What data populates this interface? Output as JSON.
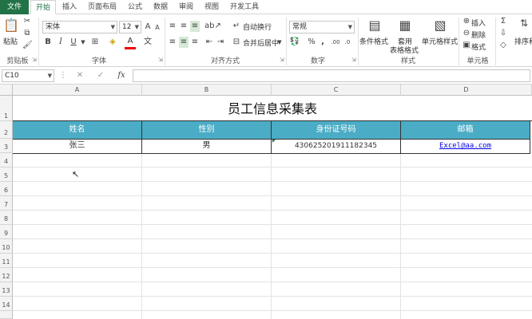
{
  "tabs": [
    "文件",
    "开始",
    "插入",
    "页面布局",
    "公式",
    "数据",
    "审阅",
    "视图",
    "开发工具"
  ],
  "clipboard": {
    "paste_label": "粘贴",
    "group_label": "剪贴板"
  },
  "font": {
    "name": "宋体",
    "size": "12",
    "bold": "B",
    "italic": "I",
    "underline": "U",
    "font_color": "A",
    "grow": "A",
    "shrink": "A",
    "group_label": "字体"
  },
  "alignment": {
    "wrap_text": "自动换行",
    "merge_center": "合并后居中",
    "group_label": "对齐方式"
  },
  "number": {
    "format": "常规",
    "group_label": "数字",
    "percent": "%",
    "comma": ",",
    "increase_decimal": ".00",
    "decrease_decimal": ".0"
  },
  "styles": {
    "conditional": "条件格式",
    "table_format_1": "套用",
    "table_format_2": "表格格式",
    "cell_styles": "单元格样式",
    "group_label": "样式"
  },
  "cells": {
    "insert": "插入",
    "delete": "删除",
    "format": "格式",
    "group_label": "单元格"
  },
  "editing": {
    "sort_filter": "排序和"
  },
  "formula_bar": {
    "name_box": "C10",
    "fx": "fx",
    "value": ""
  },
  "columns": [
    "A",
    "B",
    "C",
    "D"
  ],
  "rows": [
    "1",
    "2",
    "3",
    "4",
    "5",
    "6",
    "7",
    "8",
    "9",
    "10",
    "11",
    "12",
    "13",
    "14"
  ],
  "sheet": {
    "title": "员工信息采集表",
    "headers": [
      "姓名",
      "性别",
      "身份证号码",
      "邮箱"
    ],
    "row3": [
      "张三",
      "男",
      "430625201911182345",
      "Excel@aa.com"
    ]
  },
  "colors": {
    "header_fill": "#4bacc6",
    "file_tab": "#217346",
    "link": "#0000ee"
  }
}
